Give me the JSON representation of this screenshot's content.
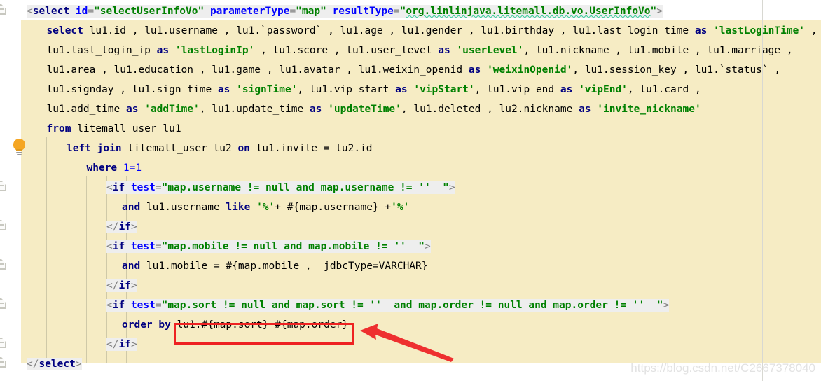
{
  "editor": {
    "colors": {
      "block_background": "#f6ecc4",
      "tag_background": "#eeeeee",
      "keyword": "#000080",
      "attribute": "#0000ff",
      "string": "#008000",
      "annotation_red": "#ee2222",
      "bulb": "#f5a623",
      "page_background": "#ffffff"
    },
    "watermark": "https://blog.csdn.net/C2667378040",
    "gutter": {
      "bulb_icon": "lightbulb-icon",
      "fold_icon": "xml-tag-fold-icon"
    }
  },
  "code": {
    "lines": [
      {
        "n": 1,
        "indent": 0,
        "tag_highlight": true,
        "tokens": [
          {
            "t": "punct",
            "v": "<"
          },
          {
            "t": "tagname",
            "v": "select"
          },
          {
            "t": "plain",
            "v": " "
          },
          {
            "t": "attr",
            "v": "id"
          },
          {
            "t": "punct",
            "v": "="
          },
          {
            "t": "str",
            "v": "\"selectUserInfoVo\""
          },
          {
            "t": "plain",
            "v": " "
          },
          {
            "t": "attr",
            "v": "parameterType"
          },
          {
            "t": "punct",
            "v": "="
          },
          {
            "t": "str",
            "v": "\"map\""
          },
          {
            "t": "plain",
            "v": " "
          },
          {
            "t": "attr",
            "v": "resultType"
          },
          {
            "t": "punct",
            "v": "="
          },
          {
            "t": "str",
            "v": "\""
          },
          {
            "t": "squig",
            "v": "org.linlinjava.litemall.db.vo.UserInfoVo"
          },
          {
            "t": "str",
            "v": "\""
          },
          {
            "t": "punct",
            "v": ">"
          }
        ]
      },
      {
        "n": 2,
        "indent": 1,
        "tag_highlight": false,
        "tokens": [
          {
            "t": "kw",
            "v": "select"
          },
          {
            "t": "plain",
            "v": " lu1.id , lu1.username , lu1.`password` , lu1.age , lu1.gender , lu1.birthday , lu1.last_login_time "
          },
          {
            "t": "kw",
            "v": "as"
          },
          {
            "t": "plain",
            "v": " "
          },
          {
            "t": "str",
            "v": "'lastLoginTime'"
          },
          {
            "t": "plain",
            "v": " ,"
          }
        ]
      },
      {
        "n": 3,
        "indent": 1,
        "tag_highlight": false,
        "tokens": [
          {
            "t": "plain",
            "v": "lu1.last_login_ip "
          },
          {
            "t": "kw",
            "v": "as"
          },
          {
            "t": "plain",
            "v": " "
          },
          {
            "t": "str",
            "v": "'lastLoginIp'"
          },
          {
            "t": "plain",
            "v": " , lu1.score , lu1.user_level "
          },
          {
            "t": "kw",
            "v": "as"
          },
          {
            "t": "plain",
            "v": " "
          },
          {
            "t": "str",
            "v": "'userLevel'"
          },
          {
            "t": "plain",
            "v": ", lu1.nickname , lu1.mobile , lu1.marriage ,"
          }
        ]
      },
      {
        "n": 4,
        "indent": 1,
        "tag_highlight": false,
        "tokens": [
          {
            "t": "plain",
            "v": "lu1.area , lu1.education , lu1.game , lu1.avatar , lu1.weixin_openid "
          },
          {
            "t": "kw",
            "v": "as"
          },
          {
            "t": "plain",
            "v": " "
          },
          {
            "t": "str",
            "v": "'weixinOpenid'"
          },
          {
            "t": "plain",
            "v": ", lu1.session_key , lu1.`status` ,"
          }
        ]
      },
      {
        "n": 5,
        "indent": 1,
        "tag_highlight": false,
        "tokens": [
          {
            "t": "plain",
            "v": "lu1.signday , lu1.sign_time "
          },
          {
            "t": "kw",
            "v": "as"
          },
          {
            "t": "plain",
            "v": " "
          },
          {
            "t": "str",
            "v": "'signTime'"
          },
          {
            "t": "plain",
            "v": ", lu1.vip_start "
          },
          {
            "t": "kw",
            "v": "as"
          },
          {
            "t": "plain",
            "v": " "
          },
          {
            "t": "str",
            "v": "'vipStart'"
          },
          {
            "t": "plain",
            "v": ", lu1.vip_end "
          },
          {
            "t": "kw",
            "v": "as"
          },
          {
            "t": "plain",
            "v": " "
          },
          {
            "t": "str",
            "v": "'vipEnd'"
          },
          {
            "t": "plain",
            "v": ", lu1.card ,"
          }
        ]
      },
      {
        "n": 6,
        "indent": 1,
        "tag_highlight": false,
        "tokens": [
          {
            "t": "plain",
            "v": "lu1.add_time "
          },
          {
            "t": "kw",
            "v": "as"
          },
          {
            "t": "plain",
            "v": " "
          },
          {
            "t": "str",
            "v": "'addTime'"
          },
          {
            "t": "plain",
            "v": ", lu1.update_time "
          },
          {
            "t": "kw",
            "v": "as"
          },
          {
            "t": "plain",
            "v": " "
          },
          {
            "t": "str",
            "v": "'updateTime'"
          },
          {
            "t": "plain",
            "v": ", lu1.deleted , lu2.nickname "
          },
          {
            "t": "kw",
            "v": "as"
          },
          {
            "t": "plain",
            "v": " "
          },
          {
            "t": "str",
            "v": "'invite_nickname'"
          }
        ]
      },
      {
        "n": 7,
        "indent": 1,
        "tag_highlight": false,
        "tokens": [
          {
            "t": "kw",
            "v": "from"
          },
          {
            "t": "plain",
            "v": " litemall_user lu1"
          }
        ]
      },
      {
        "n": 8,
        "indent": 2,
        "tag_highlight": false,
        "tokens": [
          {
            "t": "kw",
            "v": "left join"
          },
          {
            "t": "plain",
            "v": " litemall_user lu2 "
          },
          {
            "t": "kw",
            "v": "on"
          },
          {
            "t": "plain",
            "v": " lu1.invite = lu2.id"
          }
        ]
      },
      {
        "n": 9,
        "indent": 3,
        "tag_highlight": false,
        "tokens": [
          {
            "t": "kw",
            "v": "where"
          },
          {
            "t": "plain",
            "v": " "
          },
          {
            "t": "num",
            "v": "1=1"
          }
        ]
      },
      {
        "n": 10,
        "indent": 4,
        "tag_highlight": true,
        "tokens": [
          {
            "t": "punct",
            "v": "<"
          },
          {
            "t": "tagname",
            "v": "if"
          },
          {
            "t": "plain",
            "v": " "
          },
          {
            "t": "attr",
            "v": "test"
          },
          {
            "t": "punct",
            "v": "="
          },
          {
            "t": "str",
            "v": "\"map.username != null and map.username != ''  \""
          },
          {
            "t": "punct",
            "v": ">"
          }
        ]
      },
      {
        "n": 11,
        "indent": 4,
        "tag_highlight": false,
        "extra_pad": true,
        "tokens": [
          {
            "t": "kw",
            "v": "and"
          },
          {
            "t": "plain",
            "v": " lu1.username "
          },
          {
            "t": "kw",
            "v": "like"
          },
          {
            "t": "plain",
            "v": " "
          },
          {
            "t": "str",
            "v": "'%'"
          },
          {
            "t": "plain",
            "v": "+ #{map.username} +"
          },
          {
            "t": "str",
            "v": "'%'"
          }
        ]
      },
      {
        "n": 12,
        "indent": 4,
        "tag_highlight": true,
        "tokens": [
          {
            "t": "punct",
            "v": "</"
          },
          {
            "t": "tagname",
            "v": "if"
          },
          {
            "t": "punct",
            "v": ">"
          }
        ]
      },
      {
        "n": 13,
        "indent": 4,
        "tag_highlight": true,
        "tokens": [
          {
            "t": "punct",
            "v": "<"
          },
          {
            "t": "tagname",
            "v": "if"
          },
          {
            "t": "plain",
            "v": " "
          },
          {
            "t": "attr",
            "v": "test"
          },
          {
            "t": "punct",
            "v": "="
          },
          {
            "t": "str",
            "v": "\"map.mobile != null and map.mobile != ''  \""
          },
          {
            "t": "punct",
            "v": ">"
          }
        ]
      },
      {
        "n": 14,
        "indent": 4,
        "tag_highlight": false,
        "extra_pad": true,
        "tokens": [
          {
            "t": "kw",
            "v": "and"
          },
          {
            "t": "plain",
            "v": " lu1.mobile = #{map.mobile ,  jdbcType=VARCHAR}"
          }
        ]
      },
      {
        "n": 15,
        "indent": 4,
        "tag_highlight": true,
        "tokens": [
          {
            "t": "punct",
            "v": "</"
          },
          {
            "t": "tagname",
            "v": "if"
          },
          {
            "t": "punct",
            "v": ">"
          }
        ]
      },
      {
        "n": 16,
        "indent": 4,
        "tag_highlight": true,
        "tokens": [
          {
            "t": "punct",
            "v": "<"
          },
          {
            "t": "tagname",
            "v": "if"
          },
          {
            "t": "plain",
            "v": " "
          },
          {
            "t": "attr",
            "v": "test"
          },
          {
            "t": "punct",
            "v": "="
          },
          {
            "t": "str",
            "v": "\"map.sort != null and map.sort != ''  and map.order != null and map.order != ''  \""
          },
          {
            "t": "punct",
            "v": ">"
          }
        ]
      },
      {
        "n": 17,
        "indent": 4,
        "tag_highlight": false,
        "extra_pad": true,
        "tokens": [
          {
            "t": "kw",
            "v": "order by"
          },
          {
            "t": "plain",
            "v": " lu1.#{map.sort} #{map.order}"
          }
        ]
      },
      {
        "n": 18,
        "indent": 4,
        "tag_highlight": true,
        "tokens": [
          {
            "t": "punct",
            "v": "</"
          },
          {
            "t": "tagname",
            "v": "if"
          },
          {
            "t": "punct",
            "v": ">"
          }
        ]
      },
      {
        "n": 19,
        "indent": 0,
        "tag_highlight": true,
        "tokens": [
          {
            "t": "punct",
            "v": "</"
          },
          {
            "t": "tagname",
            "v": "select"
          },
          {
            "t": "punct",
            "v": ">"
          }
        ]
      }
    ]
  },
  "annotation": {
    "highlight_box_target": "lu1.#{map.sort} #{map.order}",
    "arrow": "red-arrow-pointing-left"
  }
}
